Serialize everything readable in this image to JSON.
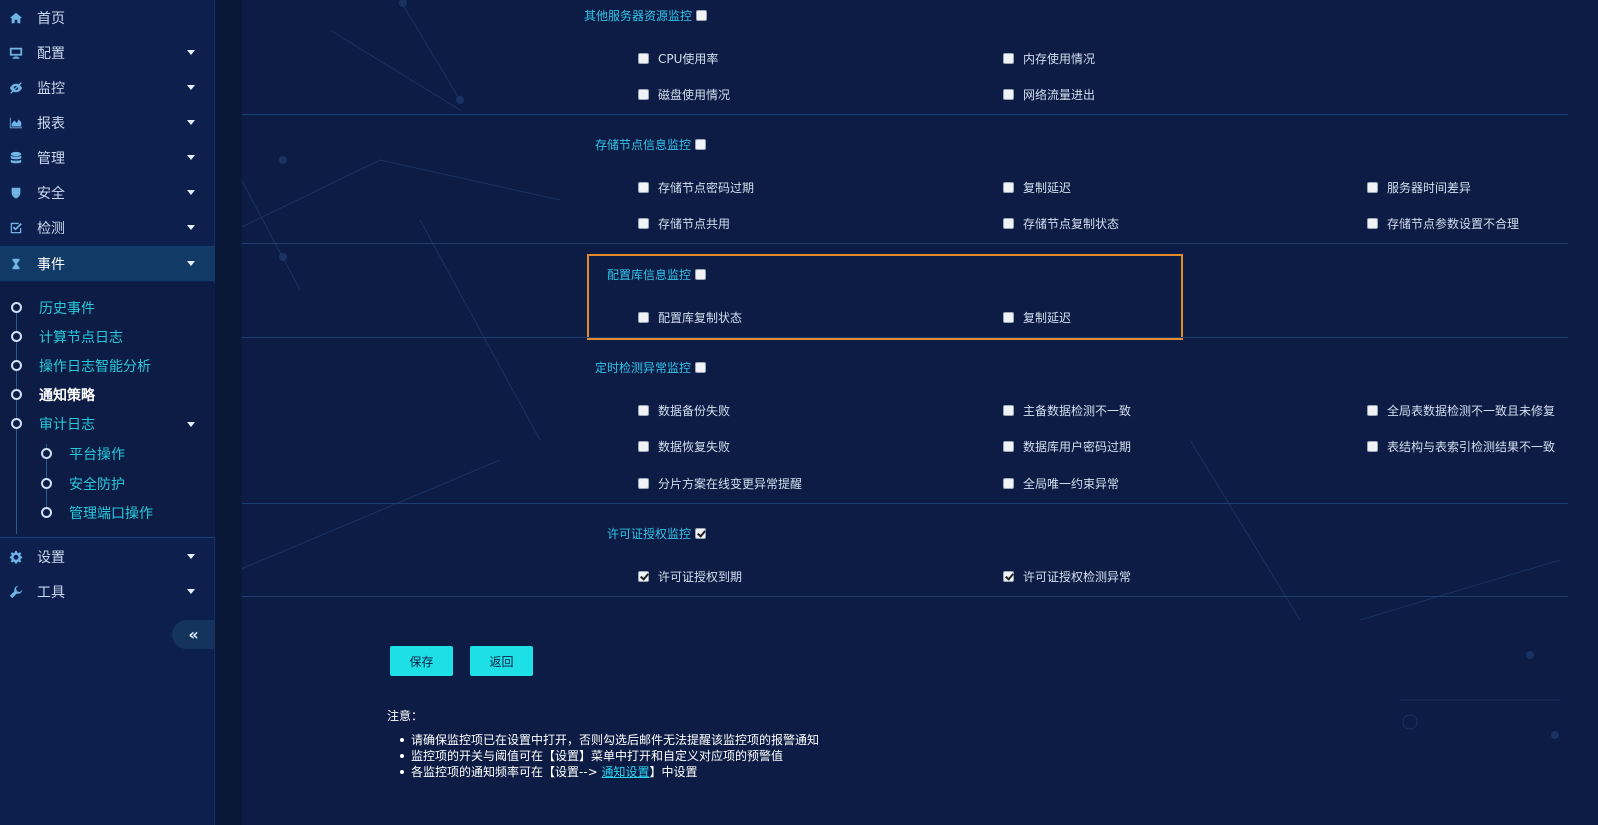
{
  "sidebar": {
    "items": [
      {
        "label": "首页",
        "icon": "home-icon"
      },
      {
        "label": "配置",
        "icon": "monitor-icon"
      },
      {
        "label": "监控",
        "icon": "eye-icon"
      },
      {
        "label": "报表",
        "icon": "area-chart-icon"
      },
      {
        "label": "管理",
        "icon": "database-icon"
      },
      {
        "label": "安全",
        "icon": "shield-icon"
      },
      {
        "label": "检测",
        "icon": "check-square-icon"
      },
      {
        "label": "事件",
        "icon": "hourglass-icon"
      },
      {
        "label": "设置",
        "icon": "gear-icon"
      },
      {
        "label": "工具",
        "icon": "wrench-icon"
      }
    ],
    "event_sub": [
      {
        "label": "历史事件"
      },
      {
        "label": "计算节点日志"
      },
      {
        "label": "操作日志智能分析"
      },
      {
        "label": "通知策略"
      },
      {
        "label": "审计日志"
      }
    ],
    "audit_sub": [
      {
        "label": "平台操作"
      },
      {
        "label": "安全防护"
      },
      {
        "label": "管理端口操作"
      }
    ],
    "collapse_glyph": "«"
  },
  "sections": {
    "other_server": {
      "title": "其他服务器资源监控",
      "checked": false,
      "options": [
        "CPU使用率",
        "内存使用情况",
        "磁盘使用情况",
        "网络流量进出"
      ]
    },
    "storage_node": {
      "title": "存储节点信息监控",
      "checked": false,
      "options": [
        "存储节点密码过期",
        "复制延迟",
        "服务器时间差异",
        "存储节点共用",
        "存储节点复制状态",
        "存储节点参数设置不合理"
      ]
    },
    "config_db": {
      "title": "配置库信息监控",
      "checked": false,
      "options": [
        "配置库复制状态",
        "复制延迟"
      ]
    },
    "scheduled": {
      "title": "定时检测异常监控",
      "checked": false,
      "options": [
        "数据备份失败",
        "主备数据检测不一致",
        "全局表数据检测不一致且未修复",
        "数据恢复失败",
        "数据库用户密码过期",
        "表结构与表索引检测结果不一致",
        "分片方案在线变更异常提醒",
        "全局唯一约束异常"
      ]
    },
    "license": {
      "title": "许可证授权监控",
      "checked": true,
      "options": [
        "许可证授权到期",
        "许可证授权检测异常"
      ]
    }
  },
  "buttons": {
    "save": "保存",
    "back": "返回"
  },
  "notes": {
    "title": "注意：",
    "line1": "请确保监控项已在设置中打开，否则勾选后邮件无法提醒该监控项的报警通知",
    "line2": "监控项的开关与阈值可在【设置】菜单中打开和自定义对应项的预警值",
    "line3_pre": "各监控项的通知频率可在【设置--> ",
    "line3_link": "通知设置",
    "line3_post": "】中设置"
  },
  "colors": {
    "accent": "#1ce0e6",
    "highlight": "#e38a2c",
    "section_title": "#34c3ea"
  }
}
